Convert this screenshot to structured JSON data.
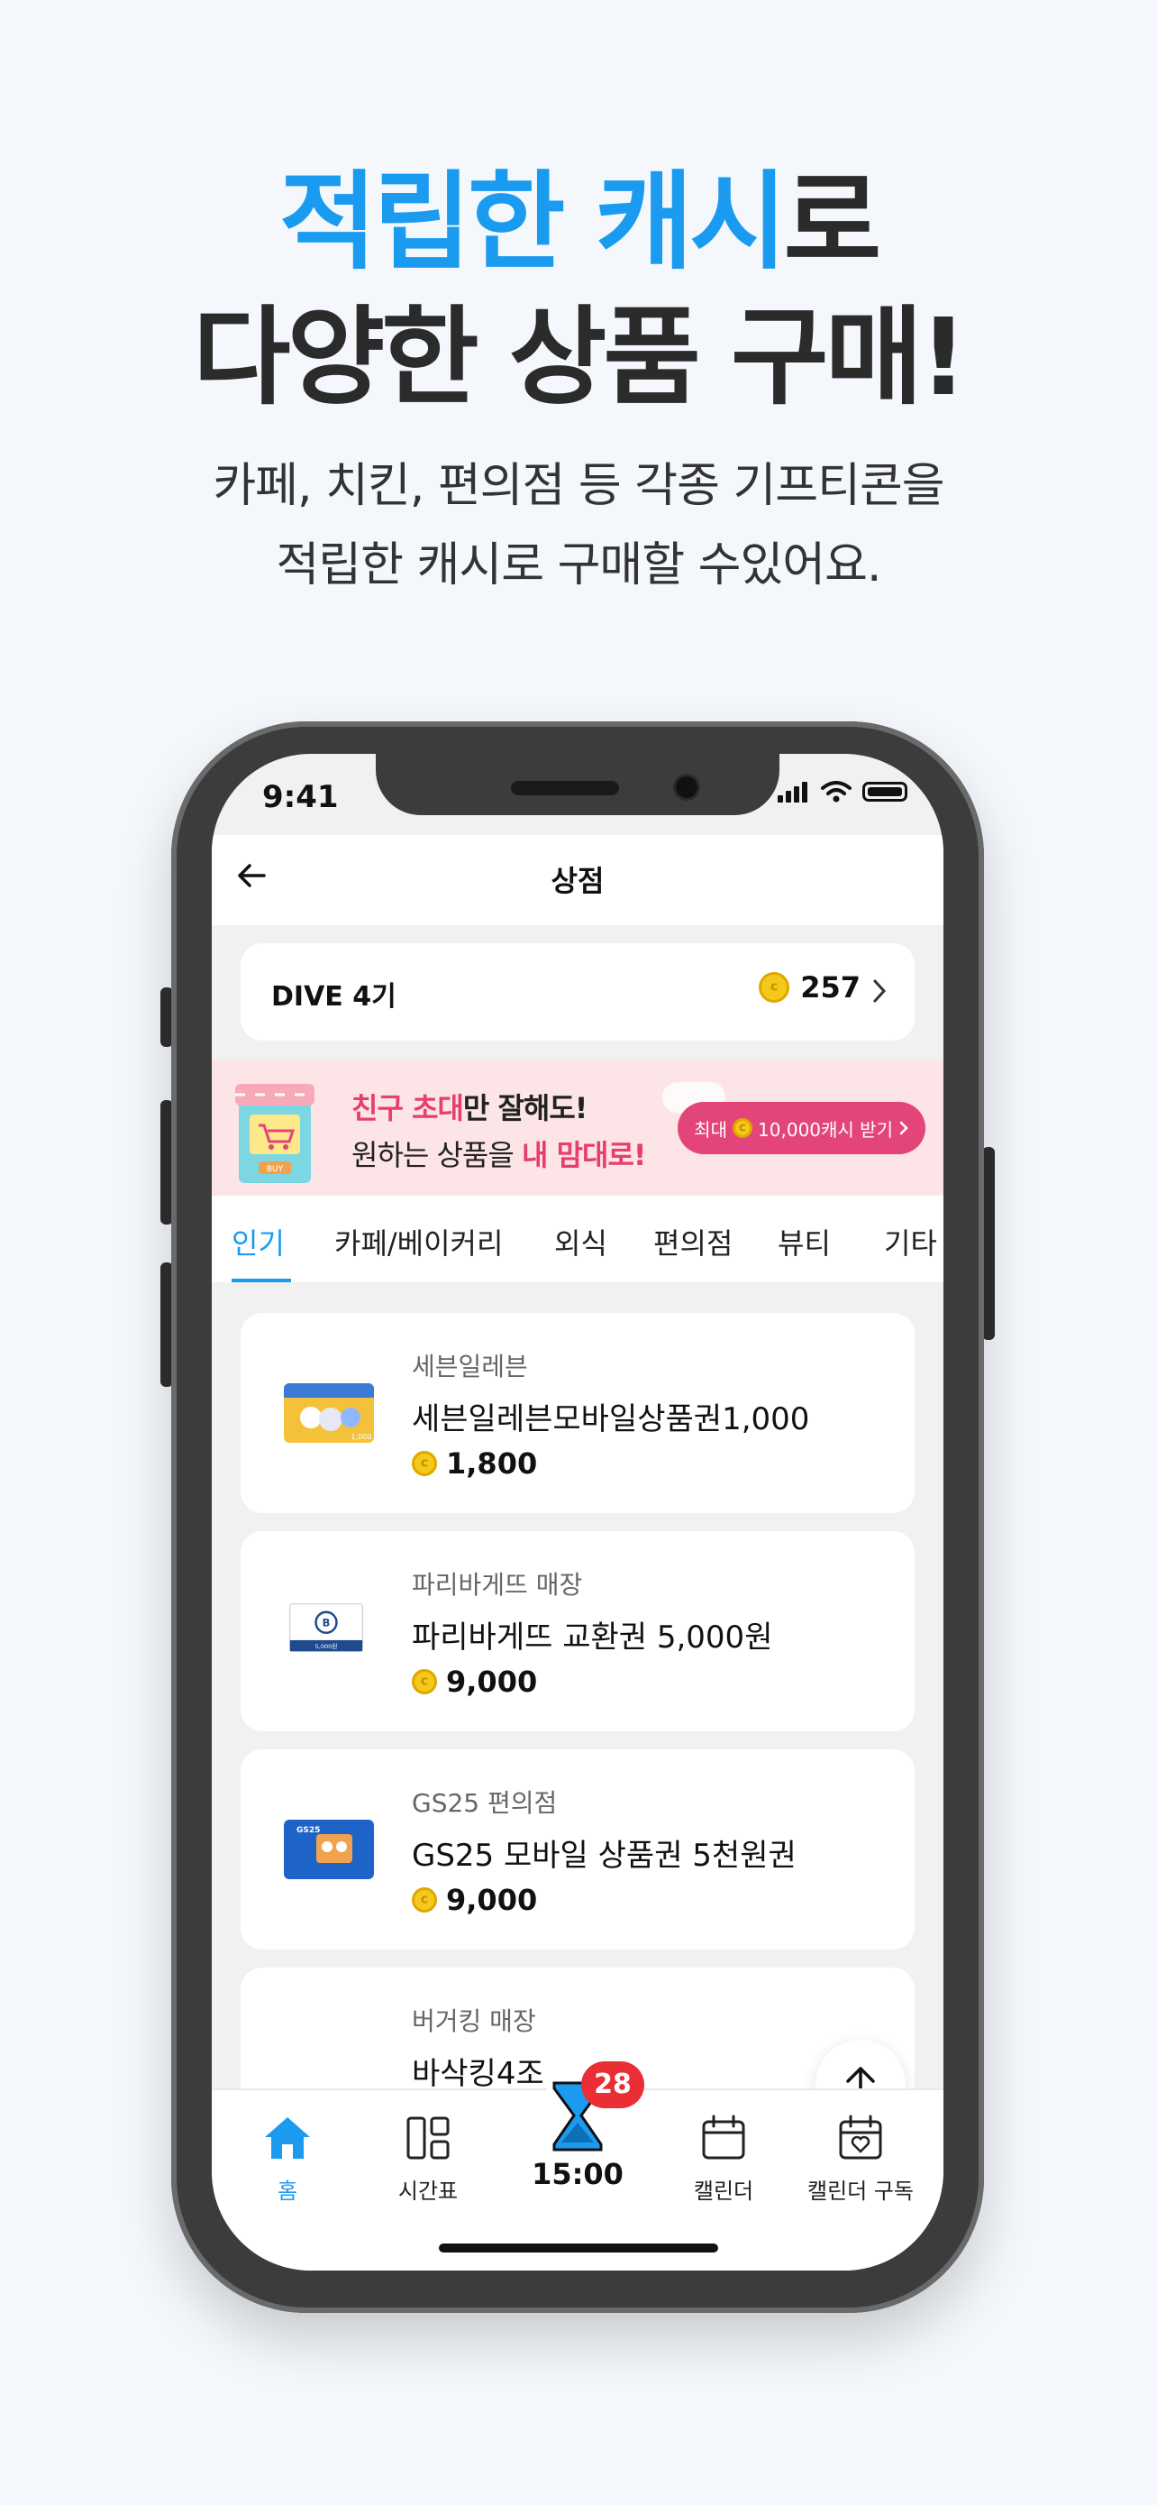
{
  "headline": {
    "line1_accent": "적립한 캐시",
    "line1_rest": "로",
    "line2": "다양한 상품 구매!"
  },
  "subtext": {
    "line1": "카페, 치킨, 편의점 등 각종 기프티콘을",
    "line2": "적립한 캐시로 구매할 수있어요."
  },
  "status_bar": {
    "time": "9:41"
  },
  "app_bar": {
    "title": "상점"
  },
  "points": {
    "label": "DIVE 4기",
    "value": "257"
  },
  "banner": {
    "line1_highlight": "친구 초대",
    "line1_rest": "만 잘해도!",
    "line2_start": "원하는 상품을 ",
    "line2_highlight": "내 맘대로!",
    "cta_prefix": "최대",
    "cta_text": "10,000캐시 받기",
    "store_label": "BUY"
  },
  "tabs": [
    "인기",
    "카페/베이커리",
    "외식",
    "편의점",
    "뷰티",
    "기타"
  ],
  "products": [
    {
      "category": "세븐일레븐",
      "name": "세븐일레븐모바일상품권1,000",
      "price": "1,800",
      "thumb_color": "#f3c23a",
      "thumb_text": "1,000"
    },
    {
      "category": "파리바게뜨 매장",
      "name": "파리바게뜨 교환권 5,000원",
      "price": "9,000",
      "thumb_color": "#ffffff",
      "thumb_text": "5,000원"
    },
    {
      "category": "GS25 편의점",
      "name": "GS25 모바일 상품권 5천원권",
      "price": "9,000",
      "thumb_color": "#1e64c8",
      "thumb_text": "GS25"
    },
    {
      "category": "버거킹 매장",
      "name": "바삭킹4조",
      "price": "",
      "thumb_color": "#ffffff",
      "thumb_text": ""
    }
  ],
  "bottom_nav": {
    "home": "홈",
    "timetable": "시간표",
    "timer_badge": "28",
    "timer_time": "15:00",
    "calendar": "캘린더",
    "calendar_subscribe": "캘린더 구독"
  },
  "colors": {
    "accent": "#1a9bf0",
    "pink": "#e3457a",
    "badge": "#e92e35",
    "coin": "#f5c91b"
  }
}
